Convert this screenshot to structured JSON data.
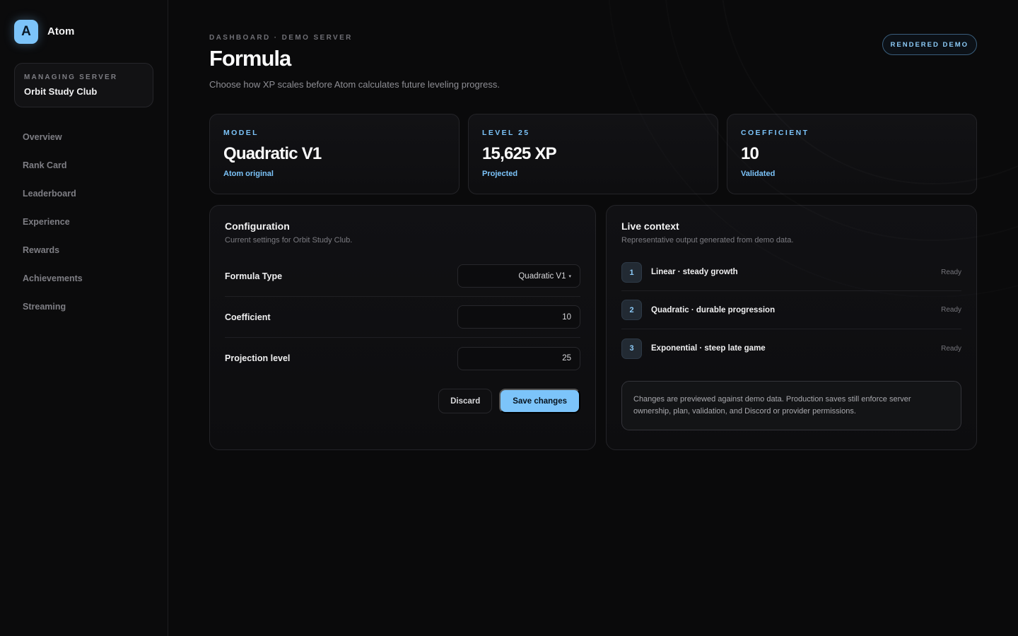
{
  "brand": {
    "logo_letter": "A",
    "name": "Atom",
    "accent": "#7cc4fa"
  },
  "server": {
    "eyebrow": "MANAGING SERVER",
    "name": "Orbit Study Club"
  },
  "nav": [
    {
      "label": "Overview"
    },
    {
      "label": "Rank Card"
    },
    {
      "label": "Leaderboard"
    },
    {
      "label": "Experience"
    },
    {
      "label": "Rewards"
    },
    {
      "label": "Achievements"
    },
    {
      "label": "Streaming"
    }
  ],
  "header": {
    "eyebrow": "DASHBOARD · DEMO SERVER",
    "title": "Formula",
    "subtitle": "Choose how XP scales before Atom calculates future leveling progress.",
    "badge": "RENDERED DEMO"
  },
  "stats": [
    {
      "eyebrow": "MODEL",
      "value": "Quadratic V1",
      "note": "Atom original"
    },
    {
      "eyebrow": "LEVEL 25",
      "value": "15,625 XP",
      "note": "Projected"
    },
    {
      "eyebrow": "COEFFICIENT",
      "value": "10",
      "note": "Validated"
    }
  ],
  "config": {
    "title": "Configuration",
    "subtitle": "Current settings for Orbit Study Club.",
    "fields": [
      {
        "label": "Formula Type",
        "value": "Quadratic V1",
        "caret": "▾"
      },
      {
        "label": "Coefficient",
        "value": "10"
      },
      {
        "label": "Projection level",
        "value": "25"
      }
    ],
    "discard_label": "Discard",
    "save_label": "Save changes"
  },
  "live": {
    "title": "Live context",
    "subtitle": "Representative output generated from demo data.",
    "items": [
      {
        "num": "1",
        "label": "Linear · steady growth",
        "status": "Ready"
      },
      {
        "num": "2",
        "label": "Quadratic · durable progression",
        "status": "Ready"
      },
      {
        "num": "3",
        "label": "Exponential · steep late game",
        "status": "Ready"
      }
    ],
    "note": "Changes are previewed against demo data. Production saves still enforce server ownership, plan, validation, and Discord or provider permissions."
  }
}
